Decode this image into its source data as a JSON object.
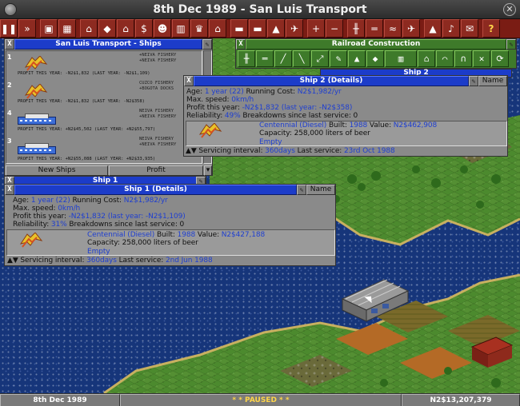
{
  "window": {
    "title": "8th Dec 1989 -  San Luis Transport",
    "close_glyph": "✕"
  },
  "toolbar": {
    "buttons": [
      {
        "icon": "pause-icon",
        "glyph": "❚❚"
      },
      {
        "icon": "fast-forward-icon",
        "glyph": "»"
      },
      {
        "icon": "disk-icon",
        "glyph": "▣"
      },
      {
        "icon": "map-icon",
        "glyph": "▦"
      },
      {
        "icon": "town-icon",
        "glyph": "⌂"
      },
      {
        "icon": "subsidies-icon",
        "glyph": "◆"
      },
      {
        "icon": "stations-icon",
        "glyph": "⌂"
      },
      {
        "icon": "finances-icon",
        "glyph": "$"
      },
      {
        "icon": "company-icon",
        "glyph": "☻"
      },
      {
        "icon": "graphs-icon",
        "glyph": "▥"
      },
      {
        "icon": "league-icon",
        "glyph": "♛"
      },
      {
        "icon": "industry-icon",
        "glyph": "⌂"
      },
      {
        "icon": "trains-icon",
        "glyph": "▬"
      },
      {
        "icon": "road-vehicles-icon",
        "glyph": "▬"
      },
      {
        "icon": "ships-icon",
        "glyph": "▲"
      },
      {
        "icon": "aircraft-icon",
        "glyph": "✈"
      },
      {
        "icon": "zoom-in-icon",
        "glyph": "+"
      },
      {
        "icon": "zoom-out-icon",
        "glyph": "−"
      },
      {
        "icon": "build-rail-icon",
        "glyph": "╫"
      },
      {
        "icon": "build-road-icon",
        "glyph": "═"
      },
      {
        "icon": "build-water-icon",
        "glyph": "≈"
      },
      {
        "icon": "build-air-icon",
        "glyph": "✈"
      },
      {
        "icon": "landscape-icon",
        "glyph": "▲"
      },
      {
        "icon": "music-icon",
        "glyph": "♪"
      },
      {
        "icon": "news-icon",
        "glyph": "✉"
      },
      {
        "icon": "help-icon",
        "glyph": "?"
      }
    ]
  },
  "ships_window": {
    "title": "San Luis Transport - Ships",
    "items": [
      {
        "number": "1",
        "orders": [
          "+NEIVA FISHERY",
          "+NEIVA FISHERY"
        ],
        "profit": "PROFIT THIS YEAR: -N2$1,832 (LAST YEAR: -N2$1,109)"
      },
      {
        "number": "2",
        "orders": [
          "CUZCO FISHERY",
          "+BOGOTA DOCKS"
        ],
        "profit": "PROFIT THIS YEAR: -N2$1,832 (LAST YEAR: -N2$358)"
      },
      {
        "number": "4",
        "orders": [
          "NEIVA FISHERY",
          "+NEIVA FISHERY"
        ],
        "profit": "PROFIT THIS YEAR: +N2$45,502 (LAST YEAR: +N2$55,797)"
      },
      {
        "number": "3",
        "orders": [
          "NEIVA FISHERY",
          "+NEIVA FISHERY"
        ],
        "profit": "PROFIT THIS YEAR: +N2$55,088 (LAST YEAR: +N2$33,935)"
      }
    ],
    "new_button": "New Ships",
    "sort_button": "Profit"
  },
  "rail_window": {
    "title": "Railroad Construction"
  },
  "ship2_header": {
    "title": "Ship 2"
  },
  "ship2": {
    "title": "Ship 2 (Details)",
    "name_button": "Name",
    "age_label": "Age:",
    "age": "1 year (22)",
    "running_label": "Running Cost:",
    "running": "N2$1,982/yr",
    "speed_label": "Max. speed:",
    "speed": "0km/h",
    "profit_label": "Profit this year:",
    "profit": "-N2$1,832  (last year: -N2$358)",
    "reliability_label": "Reliability:",
    "reliability": "49%",
    "breakdowns": "Breakdowns since last service: 0",
    "engine": "Centennial (Diesel)",
    "built_label": "Built:",
    "built": "1988",
    "value_label": "Value:",
    "value": "N2$462,908",
    "capacity": "Capacity: 258,000 liters of beer",
    "load": "Empty",
    "service_label": "Servicing interval:",
    "service_interval": "360days",
    "last_service_label": "Last service:",
    "last_service": "23rd Oct 1988"
  },
  "ship1_header": {
    "title": "Ship 1"
  },
  "ship1": {
    "title": "Ship 1 (Details)",
    "name_button": "Name",
    "age_label": "Age:",
    "age": "1 year (22)",
    "running_label": "Running Cost:",
    "running": "N2$1,982/yr",
    "speed_label": "Max. speed:",
    "speed": "0km/h",
    "profit_label": "Profit this year:",
    "profit": "-N2$1,832  (last year: -N2$1,109)",
    "reliability_label": "Reliability:",
    "reliability": "31%",
    "breakdowns": "Breakdowns since last service: 0",
    "engine": "Centennial (Diesel)",
    "built_label": "Built:",
    "built": "1988",
    "value_label": "Value:",
    "value": "N2$427,188",
    "capacity": "Capacity: 258,000 liters of beer",
    "load": "Empty",
    "service_label": "Servicing interval:",
    "service_interval": "360days",
    "last_service_label": "Last service:",
    "last_service": "2nd Jun 1988"
  },
  "statusbar": {
    "date": "8th Dec 1989",
    "status": "* *  PAUSED  * *",
    "money": "N2$13,207,379"
  },
  "colors": {
    "title_blue": "#1c3cc9",
    "window_grey": "#8a8a8a",
    "toolbar_red": "#7a1c14",
    "value_blue": "#1f3fd0",
    "water": "#16357a"
  }
}
